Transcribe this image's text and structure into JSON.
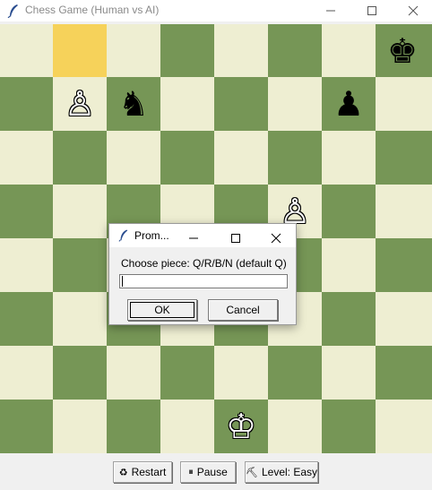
{
  "window": {
    "title": "Chess Game (Human vs AI)",
    "icon": "feather-icon"
  },
  "board": {
    "colors": {
      "light": "#eeeed2",
      "dark": "#769656",
      "highlight": "#f6d25a"
    },
    "highlighted_square": "b8",
    "pieces": [
      {
        "square": "h8",
        "glyph": "♚",
        "color": "black",
        "name": "black-king"
      },
      {
        "square": "b7",
        "glyph": "♙",
        "color": "white",
        "name": "white-pawn"
      },
      {
        "square": "c7",
        "glyph": "♞",
        "color": "black",
        "name": "black-knight"
      },
      {
        "square": "g7",
        "glyph": "♟",
        "color": "black",
        "name": "black-pawn"
      },
      {
        "square": "f5",
        "glyph": "♙",
        "color": "white",
        "name": "white-pawn"
      },
      {
        "square": "e1",
        "glyph": "♔",
        "color": "white",
        "name": "white-king"
      }
    ]
  },
  "controls": {
    "restart": {
      "icon": "♻",
      "label": "Restart"
    },
    "pause": {
      "icon": "⏸",
      "label": "Pause"
    },
    "level": {
      "icon": "⛏",
      "label": "Level: Easy"
    }
  },
  "dialog": {
    "title": "Prom...",
    "prompt": "Choose piece: Q/R/B/N (default Q)",
    "entry_value": "",
    "ok_label": "OK",
    "cancel_label": "Cancel"
  }
}
